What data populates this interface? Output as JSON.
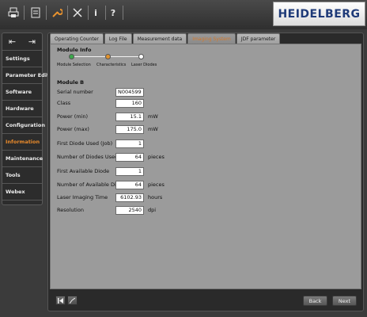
{
  "topbar": {
    "icons": [
      "printer-icon",
      "document-icon",
      "wrench-icon",
      "tools-icon",
      "info-icon",
      "help-icon"
    ],
    "info_glyph": "i",
    "help_glyph": "?",
    "brand": "HEIDELBERG"
  },
  "sidebar": {
    "arrows": [
      "⨪",
      "⨪"
    ],
    "items": [
      {
        "label": "Settings"
      },
      {
        "label": "Parameter Editor"
      },
      {
        "label": "Software"
      },
      {
        "label": "Hardware"
      },
      {
        "label": "Configuration"
      },
      {
        "label": "Information"
      },
      {
        "label": "Maintenance"
      },
      {
        "label": "Tools"
      },
      {
        "label": "Webex"
      }
    ],
    "active_color": "#e88a2b"
  },
  "tabs": [
    {
      "label": "Operating Counter"
    },
    {
      "label": "Log File"
    },
    {
      "label": "Measurement data"
    },
    {
      "label": "Imaging System"
    },
    {
      "label": "JDF parameter"
    }
  ],
  "module_info": {
    "title": "Module Info",
    "steps": [
      {
        "label": "Module Selection",
        "color": "#3aa84a"
      },
      {
        "label": "Characteristics",
        "color": "#e0922e"
      },
      {
        "label": "Laser Diodes",
        "color": "#ffffff"
      }
    ]
  },
  "module": {
    "name": "Module B",
    "fields": [
      {
        "label": "Serial number",
        "value": "N004599",
        "unit": ""
      },
      {
        "label": "Class",
        "value": "160",
        "unit": ""
      },
      {
        "label": "Power (min)",
        "value": "15.1",
        "unit": "mW"
      },
      {
        "label": "Power (max)",
        "value": "175.0",
        "unit": "mW"
      },
      {
        "label": "First Diode Used (Job)",
        "value": "1",
        "unit": ""
      },
      {
        "label": "Number of Diodes Used (Job)",
        "value": "64",
        "unit": "pieces"
      },
      {
        "label": "First Available Diode",
        "value": "1",
        "unit": ""
      },
      {
        "label": "Number of Available Diodes",
        "value": "64",
        "unit": "pieces"
      },
      {
        "label": "Laser Imaging Time",
        "value": "6102.93",
        "unit": "hours"
      },
      {
        "label": "Resolution",
        "value": "2540",
        "unit": "dpi"
      }
    ]
  },
  "footer": {
    "back_label": "Back",
    "next_label": "Next"
  }
}
